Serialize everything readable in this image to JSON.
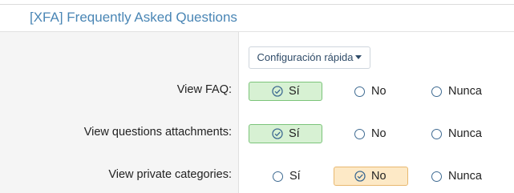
{
  "section": {
    "title": "[XFA] Frequently Asked Questions"
  },
  "quick_config": {
    "label": "Configuración rápida",
    "icon": "caret-down-icon"
  },
  "permissions": [
    {
      "label": "View FAQ:",
      "options": [
        {
          "label": "Sí",
          "selected": true
        },
        {
          "label": "No",
          "selected": false
        },
        {
          "label": "Nunca",
          "selected": false
        }
      ]
    },
    {
      "label": "View questions attachments:",
      "options": [
        {
          "label": "Sí",
          "selected": true
        },
        {
          "label": "No",
          "selected": false
        },
        {
          "label": "Nunca",
          "selected": false
        }
      ]
    },
    {
      "label": "View private categories:",
      "options": [
        {
          "label": "Sí",
          "selected": false
        },
        {
          "label": "No",
          "selected": true
        },
        {
          "label": "Nunca",
          "selected": false
        }
      ]
    }
  ],
  "colors": {
    "title": "#4a86b5",
    "allow_bg": "#d7f1d3",
    "allow_border": "#7cc47a",
    "deny_bg": "#fde9c6",
    "deny_border": "#e8b870",
    "radio": "#3f6b92"
  }
}
